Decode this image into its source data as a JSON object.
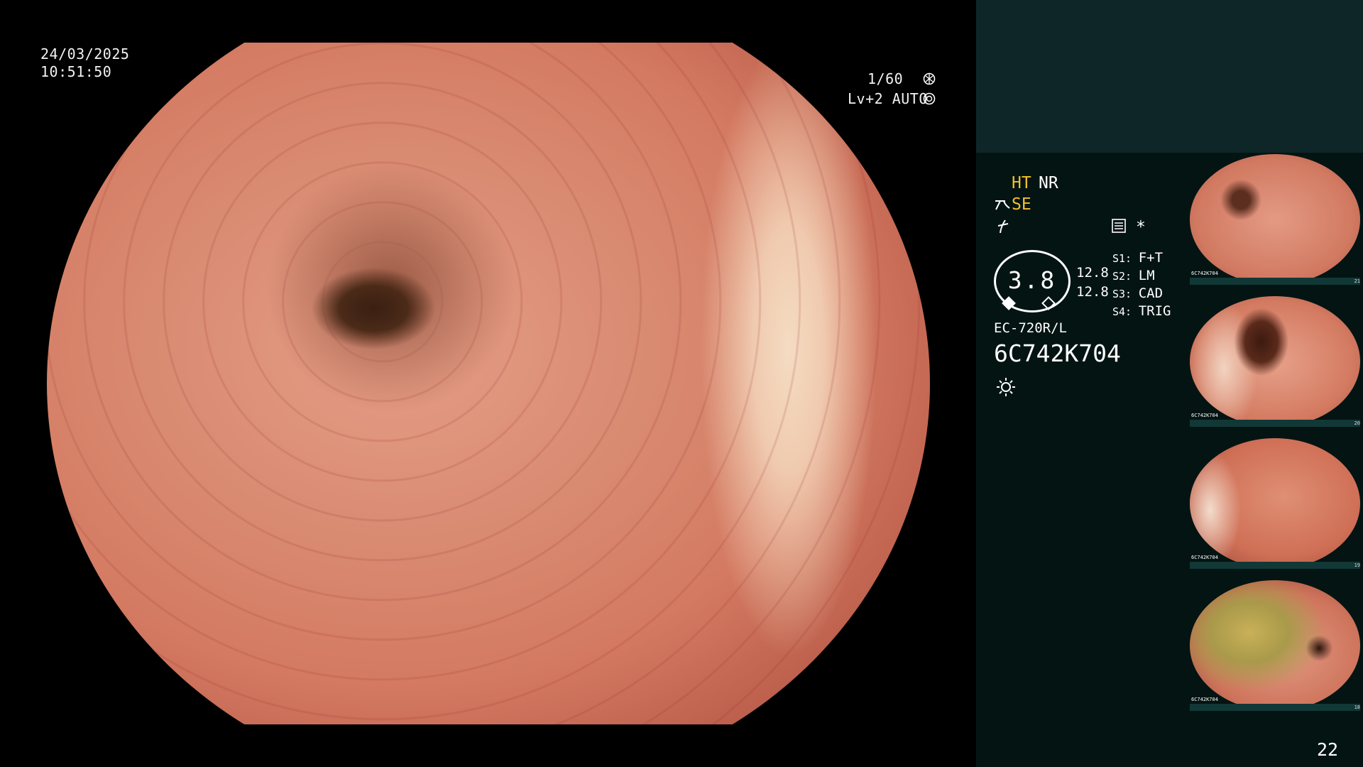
{
  "overlay": {
    "date": "24/03/2025",
    "time": "10:51:50",
    "shutter": "1/60",
    "level": "Lv+2 AUTO"
  },
  "panel": {
    "mode1": "HT",
    "mode2": "NR",
    "se": "SE",
    "gauge_value": "3.8",
    "gauge_side_top": "12.8",
    "gauge_side_bottom": "12.8",
    "settings": [
      {
        "key": "S1:",
        "value": "F+T"
      },
      {
        "key": "S2:",
        "value": "LM"
      },
      {
        "key": "S3:",
        "value": "CAD"
      },
      {
        "key": "S4:",
        "value": "TRIG"
      }
    ],
    "scope_model": "EC-720R/L",
    "serial": "6C742K704",
    "star": "*",
    "page_number": "22"
  },
  "thumbnails": [
    {
      "label": "6C742K704",
      "index": "21"
    },
    {
      "label": "6C742K704",
      "index": "20"
    },
    {
      "label": "6C742K704",
      "index": "19"
    },
    {
      "label": "6C742K704",
      "index": "18"
    }
  ],
  "icons": [
    "shutter-icon",
    "auto-exposure-icon",
    "scope-icon",
    "flash-icon",
    "memory-icon",
    "light-icon"
  ],
  "colors": {
    "accent_yellow": "#f2c02e",
    "panel_bg": "#041413",
    "header_bg": "#0f2628"
  }
}
